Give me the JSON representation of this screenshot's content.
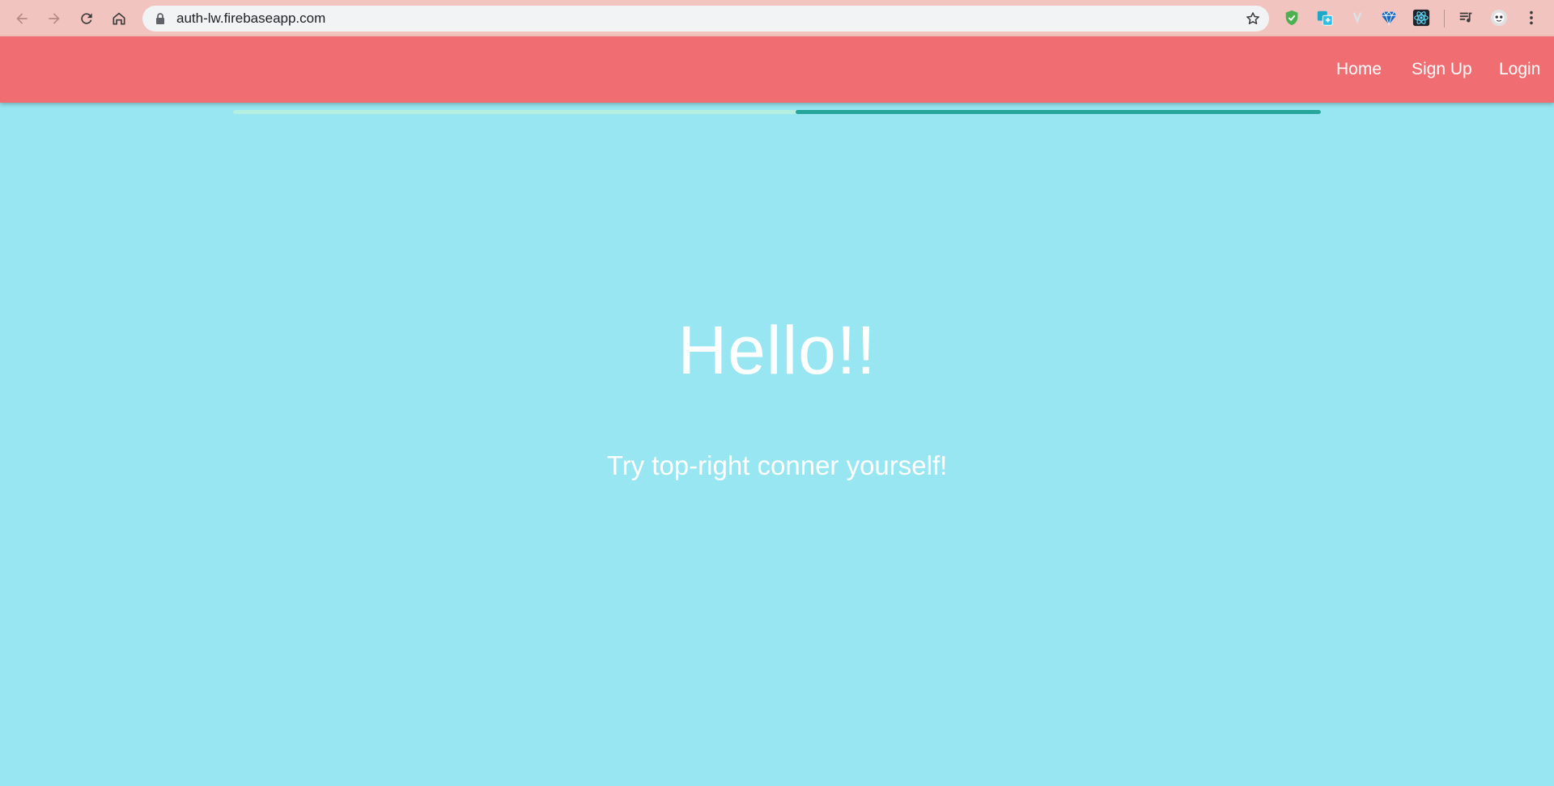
{
  "browser": {
    "url": "auth-lw.firebaseapp.com",
    "icons": [
      "back-icon",
      "forward-icon",
      "reload-icon",
      "home-icon",
      "lock-icon",
      "bookmark-star-icon",
      "adblock-shield-icon",
      "translate-extension-icon",
      "vuetify-extension-icon",
      "gem-extension-icon",
      "react-devtools-icon",
      "media-playlist-icon",
      "profile-avatar-icon",
      "menu-kebab-icon"
    ]
  },
  "navbar": {
    "links": [
      "Home",
      "Sign Up",
      "Login"
    ],
    "background": "#f06e72"
  },
  "progress": {
    "indeterminate_segment_start": 0.517,
    "indeterminate_segment_end": 1.0,
    "track_color": "#b5efdf",
    "fill_color": "#26a69a"
  },
  "hero": {
    "title": "Hello!!",
    "subtitle": "Try top-right conner yourself!"
  },
  "colors": {
    "page_background": "#98e6f1",
    "chrome_background": "#f2c4bf"
  }
}
